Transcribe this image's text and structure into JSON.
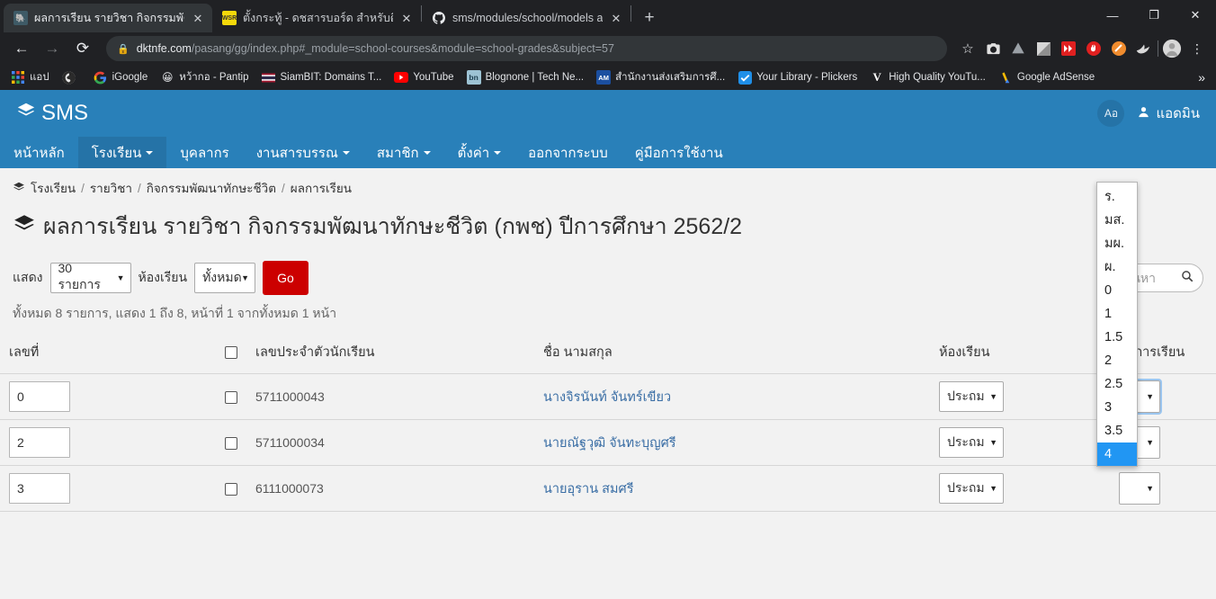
{
  "browser": {
    "tabs": [
      {
        "title": "ผลการเรียน รายวิชา กิจกรรมพัฒนาทัก",
        "favicon": "elephant-favicon",
        "active": true
      },
      {
        "title": "ตั้งกระทู้ - ดชสารบอร์ด สำหรับติดต่อสื",
        "favicon": "wsr-favicon",
        "active": false
      },
      {
        "title": "sms/modules/school/models at n",
        "favicon": "github-favicon",
        "active": false
      }
    ],
    "newtab_label": "+",
    "window_controls": {
      "minimize": "—",
      "maximize": "❐",
      "close": "✕"
    },
    "nav": {
      "back": "←",
      "forward": "→",
      "reload": "⟳"
    },
    "omnibox": {
      "lock_icon": "lock-icon",
      "url_domain": "dktnfe.com",
      "url_path": "/pasang/gg/index.php#_module=school-courses&module=school-grades&subject=57"
    },
    "toolbar_icons": [
      "bookmark-star-icon",
      "camera-icon",
      "drive-icon",
      "square-icon",
      "fast-forward-icon",
      "adblock-hand-icon",
      "orange-circle-icon",
      "shark-icon",
      "profile-avatar-icon",
      "three-dot-menu-icon"
    ],
    "bookmarks": [
      {
        "label": "แอป",
        "icon": "apps-grid-icon"
      },
      {
        "label": "",
        "icon": "globe-icon"
      },
      {
        "label": "iGoogle",
        "icon": "google-g-icon"
      },
      {
        "label": "หว้ากอ - Pantip",
        "icon": "pantip-icon"
      },
      {
        "label": "SiamBIT: Domains T...",
        "icon": "thai-flag-icon"
      },
      {
        "label": "YouTube",
        "icon": "youtube-icon"
      },
      {
        "label": "Blognone | Tech Ne...",
        "icon": "blognone-icon"
      },
      {
        "label": "สำนักงานส่งเสริมการศึ...",
        "icon": "am-icon"
      },
      {
        "label": "Your Library - Plickers",
        "icon": "plickers-check-icon"
      },
      {
        "label": "High Quality YouTu...",
        "icon": "v-icon"
      },
      {
        "label": "Google AdSense",
        "icon": "adsense-icon"
      }
    ],
    "bookmarks_overflow": "»"
  },
  "app": {
    "brand": "SMS",
    "brand_icon": "layers-icon",
    "lang_badge": "Aอ",
    "user_icon": "user-icon",
    "user_name": "แอดมิน",
    "nav_items": [
      {
        "label": "หน้าหลัก",
        "caret": false,
        "active": false
      },
      {
        "label": "โรงเรียน",
        "caret": true,
        "active": true
      },
      {
        "label": "บุคลากร",
        "caret": false,
        "active": false
      },
      {
        "label": "งานสารบรรณ",
        "caret": true,
        "active": false
      },
      {
        "label": "สมาชิก",
        "caret": true,
        "active": false
      },
      {
        "label": "ตั้งค่า",
        "caret": true,
        "active": false
      },
      {
        "label": "ออกจากระบบ",
        "caret": false,
        "active": false
      },
      {
        "label": "คู่มือการใช้งาน",
        "caret": false,
        "active": false
      }
    ],
    "breadcrumb": {
      "icon": "layers-icon",
      "items": [
        "โรงเรียน",
        "รายวิชา",
        "กิจกรรมพัฒนาทักษะชีวิต",
        "ผลการเรียน"
      ],
      "separator": "/"
    },
    "page_title": "ผลการเรียน รายวิชา กิจกรรมพัฒนาทักษะชีวิต (กพช) ปีการศึกษา 2562/2",
    "page_title_icon": "graduation-layers-icon",
    "toolbar": {
      "show_label": "แสดง",
      "per_page_value": "30 รายการ",
      "room_label": "ห้องเรียน",
      "room_value": "ทั้งหมด",
      "go_label": "Go",
      "search_placeholder": "ค้นหา",
      "search_value": "",
      "search_icon": "search-icon"
    },
    "summary": "ทั้งหมด 8 รายการ, แสดง 1 ถึง 8, หน้าที่ 1 จากทั้งหมด 1 หน้า",
    "table": {
      "columns": [
        "เลขที่",
        "",
        "เลขประจำตัวนักเรียน",
        "ชื่อ นามสกุล",
        "ห้องเรียน",
        "ผลการเรียน"
      ],
      "rows": [
        {
          "no": "0",
          "checked": false,
          "student_id": "5711000043",
          "name": "นางจิรนันท์ จันทร์เขียว",
          "room": "ประถม",
          "grade": ""
        },
        {
          "no": "2",
          "checked": false,
          "student_id": "5711000034",
          "name": "นายณัฐวุฒิ จันทะบุญศรี",
          "room": "ประถม",
          "grade": ""
        },
        {
          "no": "3",
          "checked": false,
          "student_id": "6111000073",
          "name": "นายอุราน สมศรี",
          "room": "ประถม",
          "grade": ""
        }
      ]
    },
    "grade_dropdown": {
      "open": true,
      "options": [
        "ร.",
        "มส.",
        "มผ.",
        "ผ.",
        "0",
        "1",
        "1.5",
        "2",
        "2.5",
        "3",
        "3.5",
        "4"
      ],
      "selected": "4"
    },
    "colors": {
      "primary": "#2980b9",
      "primary_active": "#2573a7",
      "go_button": "#cc0000",
      "dropdown_highlight": "#2196f3",
      "link": "#3a6ea5"
    }
  }
}
